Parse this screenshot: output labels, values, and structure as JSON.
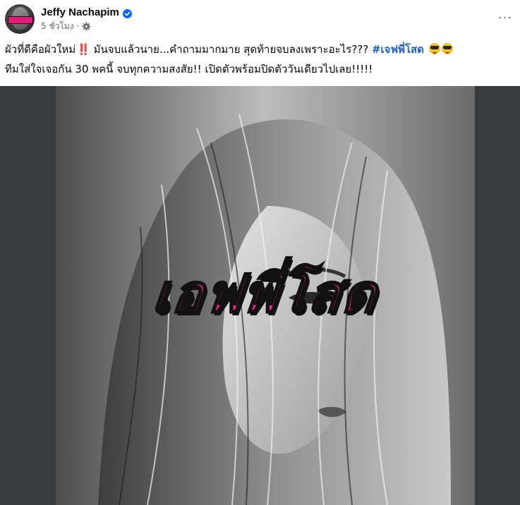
{
  "post": {
    "author": {
      "name": "Jeffy Nachapim",
      "verified": true,
      "verified_color": "#0866ff",
      "avatar_brand_color": "#e6187a"
    },
    "meta": {
      "time": "5 ชั่วโมง",
      "separator": "·",
      "audience_icon": "gear-icon"
    },
    "more_icon": "···",
    "caption": {
      "line1_text": "ผัวที่ดีคือผัวใหม่",
      "line1_emoji1": "‼️",
      "line1_text2": " มันจบแล้วนาย...คำถามมากมาย สุดท้ายจบลงเพราะอะไร??? ",
      "hashtag": "#เจฟพี่โสด",
      "emoji_trailing": "sunglasses-emoji x2",
      "line2": "ทีมใส่ใจเจอกัน 30 พคนี้ จบทุกความสงสัย!! เปิดตัวพร้อมปิดตัววันเดียวไปเลย!!!!!"
    },
    "media": {
      "overlay_text": "เอฟพี่โสด",
      "overlay_color": "#ff1f86",
      "background_color": "#3a3b3d"
    }
  }
}
